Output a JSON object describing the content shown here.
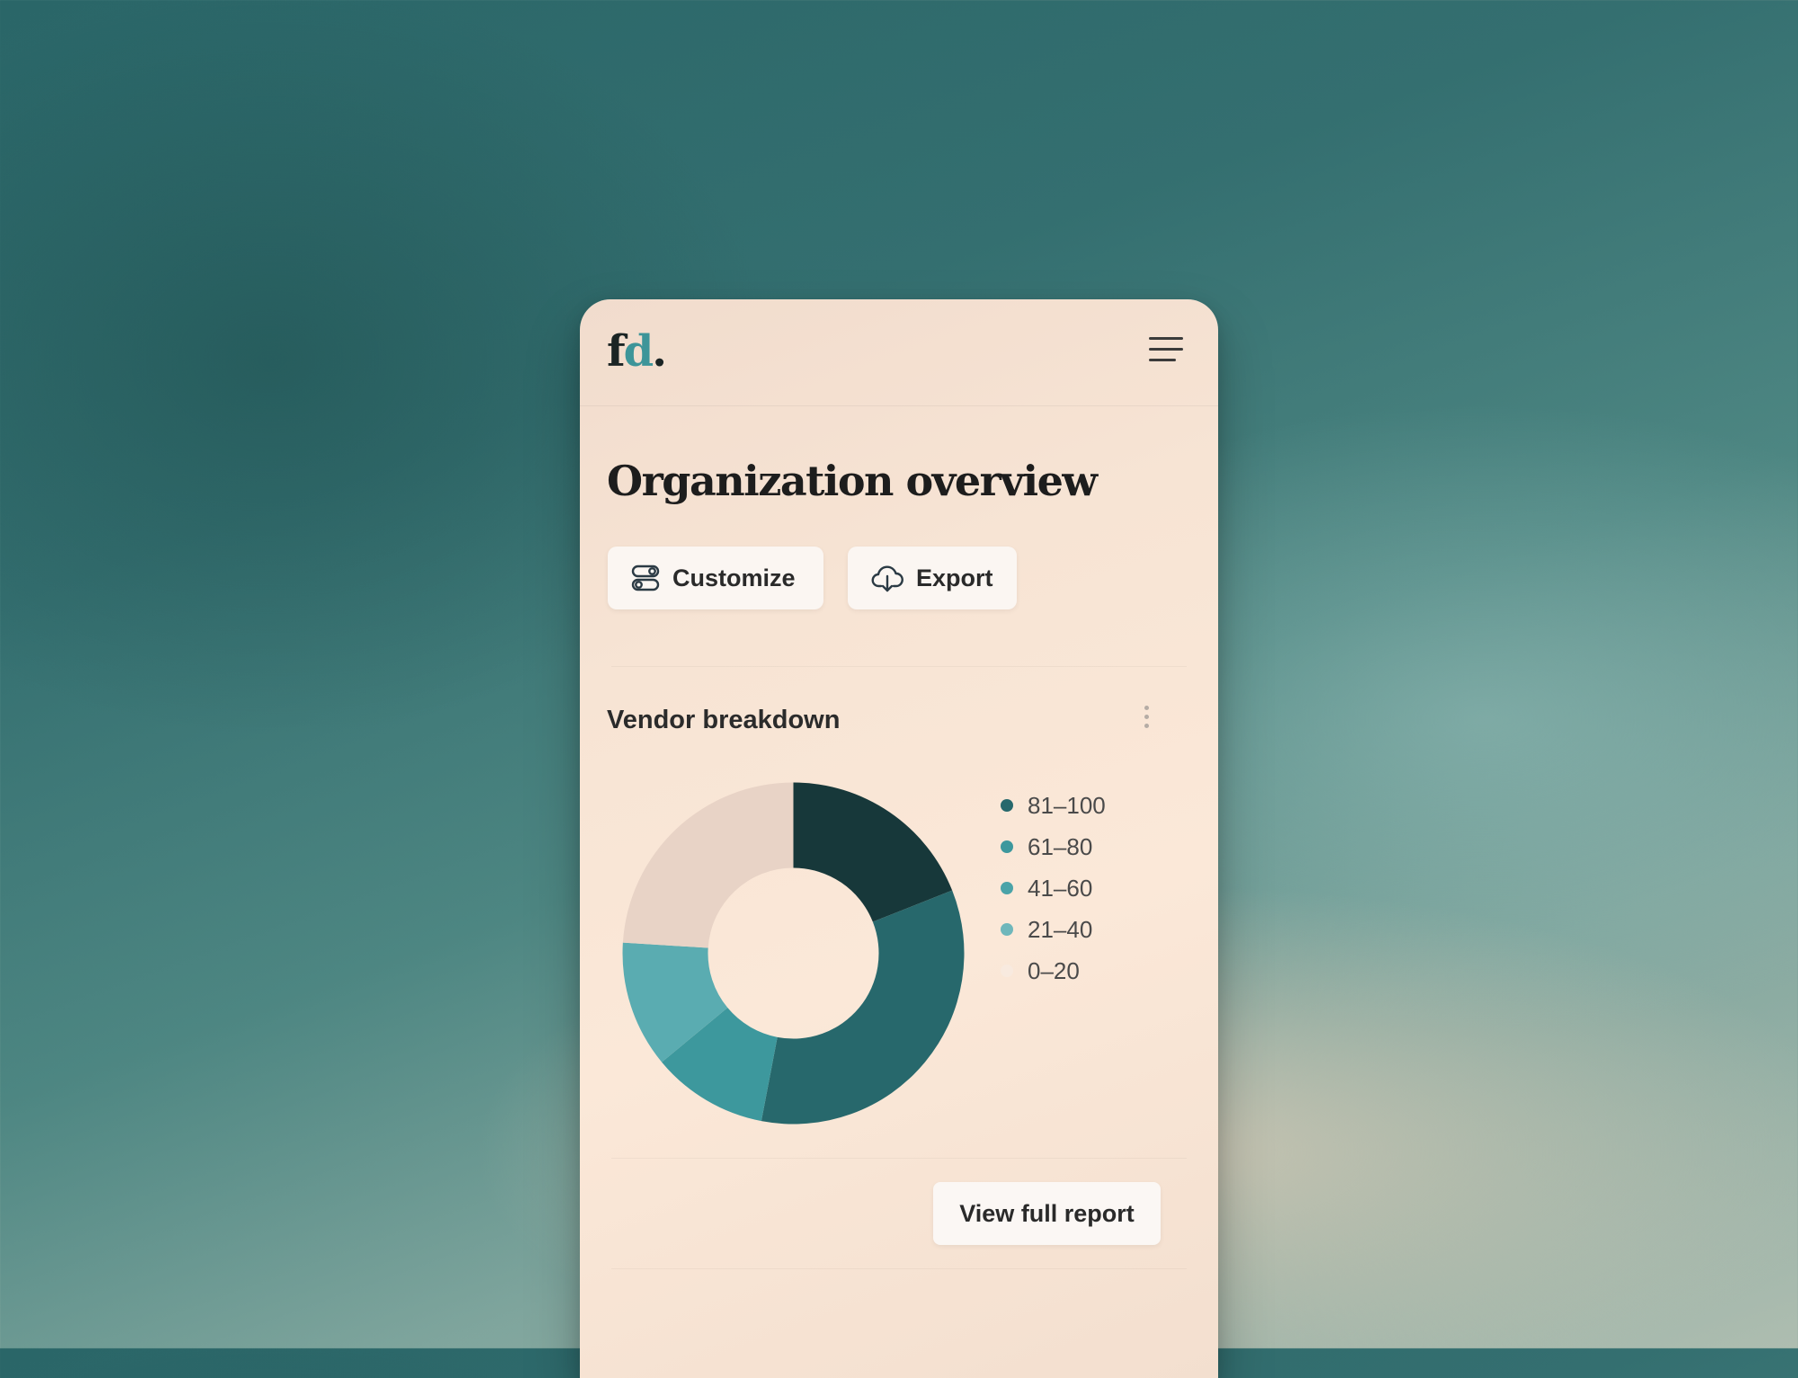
{
  "brand": {
    "logo_part1": "f",
    "logo_part2": "d",
    "logo_part3": ".",
    "accent_color": "#3d9599"
  },
  "header": {
    "menu_icon": "hamburger-menu-icon"
  },
  "page": {
    "title": "Organization overview"
  },
  "toolbar": {
    "customize_label": "Customize",
    "customize_icon": "toggles-icon",
    "export_label": "Export",
    "export_icon": "cloud-download-icon"
  },
  "card": {
    "title": "Vendor breakdown",
    "more_icon": "vertical-ellipsis-icon",
    "view_report_label": "View full report"
  },
  "chart_data": {
    "type": "pie",
    "donut": true,
    "categories": [
      "81–100",
      "61–80",
      "41–60",
      "21–40",
      "0–20"
    ],
    "values": [
      19,
      34,
      11,
      12,
      24
    ],
    "colors": [
      "#17383a",
      "#27686c",
      "#3d989d",
      "#5aacb1",
      "#e8d3c6"
    ],
    "legend_colors": [
      "#27686c",
      "#3d989d",
      "#4aa3a8",
      "#6fb7bb",
      "#f8eadf"
    ],
    "legend_position": "right"
  }
}
